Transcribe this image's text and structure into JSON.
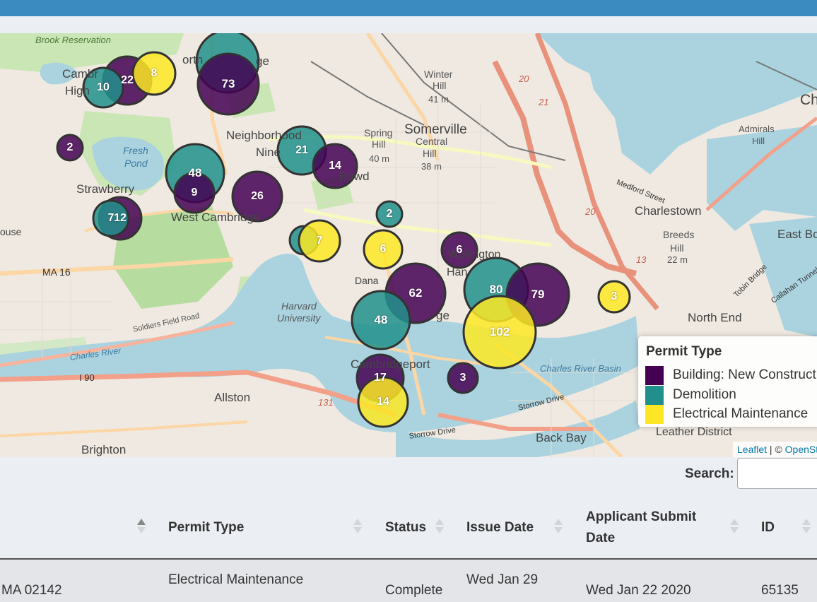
{
  "map": {
    "place_labels": [
      "Brook Reservation",
      "Cambr",
      "High",
      "Neighborhood",
      "Nine",
      "Somerville",
      "Winter",
      "Hill",
      "41 m",
      "Spring",
      "Hill",
      "40 m",
      "Central",
      "Hill",
      "38 m",
      "Fresh",
      "Pond",
      "Strawberry",
      "West Cambridge",
      "Harvard",
      "University",
      "Cambridgeport",
      "Allston",
      "Brighton",
      "Charlestown",
      "Breeds",
      "Hill",
      "22 m",
      "East Bo",
      "North End",
      "Admirals",
      "Hill",
      "Ch",
      "Back Bay",
      "Leather District",
      "Charles River Basin",
      "Charles River",
      "Soldiers Field Road",
      "Storrow Drive",
      "Storrow Drive",
      "Medford Street",
      "Dana",
      "Wellington",
      "Han",
      "Tobin Bridge",
      "Callahan Tunnel",
      "ouse",
      "MA 16",
      "I 90",
      "20",
      "21",
      "20",
      "13",
      "131",
      "Bowd",
      "orth",
      "ge",
      "ge"
    ],
    "markers": [
      {
        "label": "22",
        "type": "building"
      },
      {
        "label": "8",
        "type": "electrical"
      },
      {
        "label": "10",
        "type": "demolition"
      },
      {
        "label": "",
        "type": "demolition"
      },
      {
        "label": "73",
        "type": "building"
      },
      {
        "label": "2",
        "type": "building"
      },
      {
        "label": "21",
        "type": "demolition"
      },
      {
        "label": "14",
        "type": "building"
      },
      {
        "label": "48",
        "type": "demolition"
      },
      {
        "label": "9",
        "type": "building"
      },
      {
        "label": "26",
        "type": "building"
      },
      {
        "label": "12",
        "type": "building"
      },
      {
        "label": "7",
        "type": "demolition"
      },
      {
        "label": "2",
        "type": "demolition"
      },
      {
        "label": "",
        "type": "demolition"
      },
      {
        "label": "7",
        "type": "electrical"
      },
      {
        "label": "6",
        "type": "electrical"
      },
      {
        "label": "6",
        "type": "building"
      },
      {
        "label": "62",
        "type": "building"
      },
      {
        "label": "80",
        "type": "demolition"
      },
      {
        "label": "79",
        "type": "building"
      },
      {
        "label": "3",
        "type": "electrical"
      },
      {
        "label": "48",
        "type": "demolition"
      },
      {
        "label": "102",
        "type": "electrical"
      },
      {
        "label": "17",
        "type": "building"
      },
      {
        "label": "3",
        "type": "building"
      },
      {
        "label": "14",
        "type": "electrical"
      }
    ],
    "legend": {
      "title": "Permit Type",
      "items": [
        {
          "label": "Building: New Construction",
          "color": "#440154"
        },
        {
          "label": "Demolition",
          "color": "#21908c"
        },
        {
          "label": "Electrical Maintenance",
          "color": "#fde725"
        }
      ]
    },
    "attribution": {
      "leaflet": "Leaflet",
      "sep": " | © ",
      "osm": "OpenStreetMap"
    }
  },
  "colors": {
    "building": "#440154",
    "demolition": "#21908c",
    "electrical": "#fde725",
    "topbar": "#3b8bc0"
  },
  "search": {
    "label": "Search:",
    "value": ""
  },
  "table": {
    "columns": [
      "",
      "Permit Type",
      "Status",
      "Issue Date",
      "Applicant Submit Date",
      "ID"
    ],
    "rows": [
      {
        "address": "MA 02142",
        "permit_type": "Electrical Maintenance",
        "status": "Complete",
        "issue_date": "Wed Jan 29",
        "submit_date": "Wed Jan 22 2020",
        "id": "65135"
      }
    ]
  }
}
